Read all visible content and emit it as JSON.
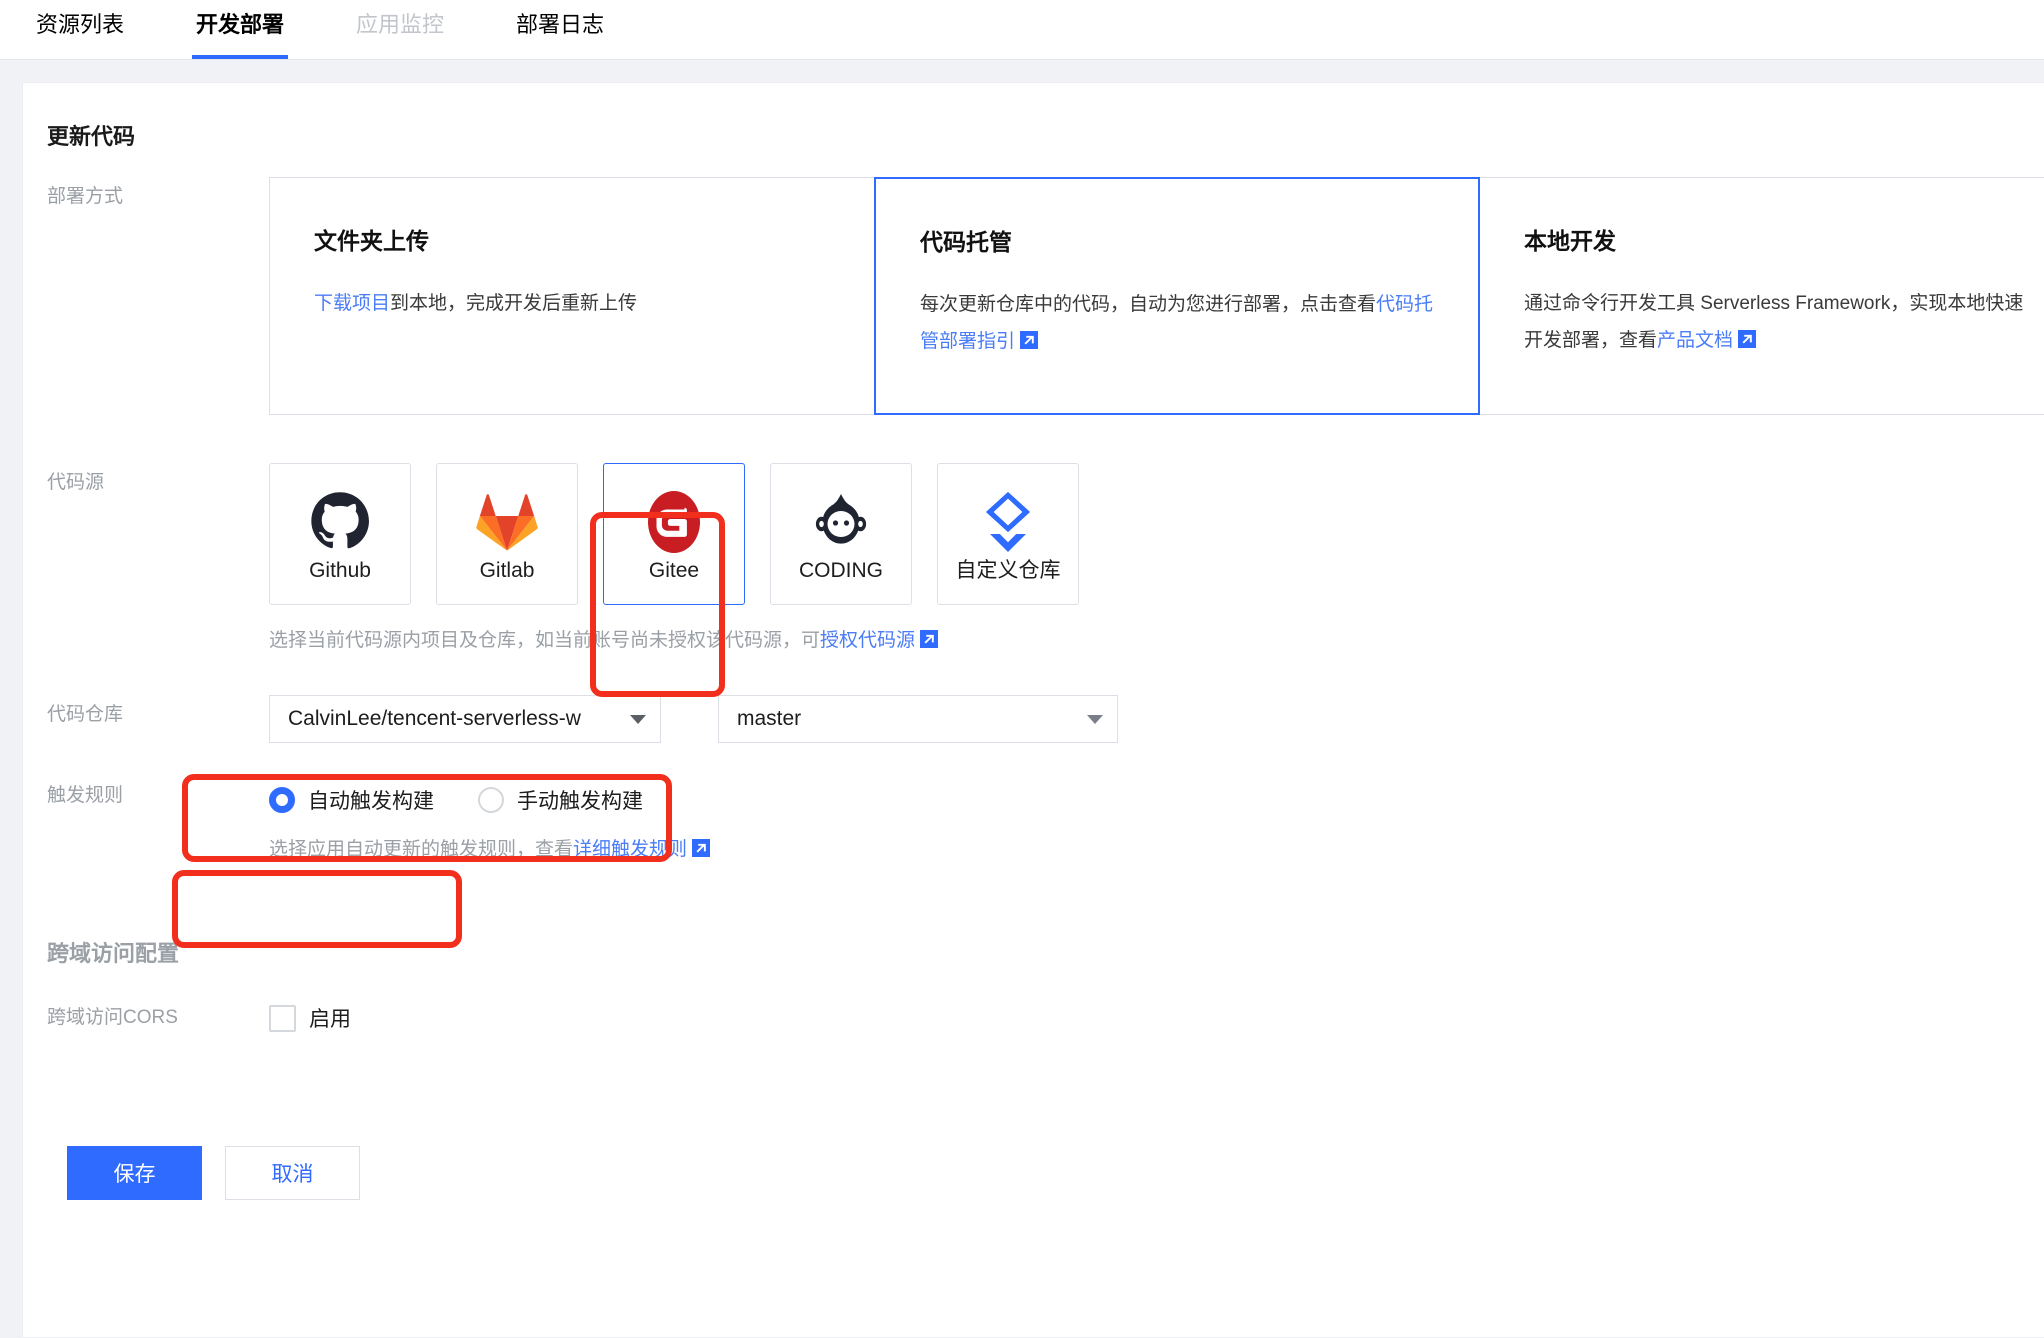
{
  "tabs": [
    {
      "label": "资源列表",
      "active": false,
      "muted": false
    },
    {
      "label": "开发部署",
      "active": true,
      "muted": false
    },
    {
      "label": "应用监控",
      "active": false,
      "muted": true
    },
    {
      "label": "部署日志",
      "active": false,
      "muted": false
    }
  ],
  "update_code": {
    "title": "更新代码",
    "deploy_method": {
      "label": "部署方式",
      "cards": [
        {
          "title": "文件夹上传",
          "desc_prefix": "",
          "link": "下载项目",
          "desc_suffix": "到本地，完成开发后重新上传",
          "has_external_icon": false,
          "selected": false
        },
        {
          "title": "代码托管",
          "desc_prefix": "每次更新仓库中的代码，自动为您进行部署，点击查看",
          "link": "代码托管部署指引",
          "desc_suffix": "",
          "has_external_icon": true,
          "selected": true
        },
        {
          "title": "本地开发",
          "desc_prefix": "通过命令行开发工具 Serverless Framework，实现本地快速开发部署，查看",
          "link": "产品文档",
          "desc_suffix": "",
          "has_external_icon": true,
          "selected": false
        }
      ]
    },
    "code_source": {
      "label": "代码源",
      "tiles": [
        {
          "label": "Github",
          "icon": "github-icon",
          "selected": false
        },
        {
          "label": "Gitlab",
          "icon": "gitlab-icon",
          "selected": false
        },
        {
          "label": "Gitee",
          "icon": "gitee-icon",
          "selected": true
        },
        {
          "label": "CODING",
          "icon": "coding-icon",
          "selected": false
        },
        {
          "label": "自定义仓库",
          "icon": "custom-repo-icon",
          "selected": false
        }
      ],
      "hint_prefix": "选择当前代码源内项目及仓库，如当前账号尚未授权该代码源，可",
      "hint_link": "授权代码源"
    },
    "code_repo": {
      "label": "代码仓库",
      "repo_value": "CalvinLee/tencent-serverless-w",
      "branch_value": "master"
    },
    "trigger_rule": {
      "label": "触发规则",
      "options": [
        {
          "label": "自动触发构建",
          "checked": true
        },
        {
          "label": "手动触发构建",
          "checked": false
        }
      ],
      "hint_prefix": "选择应用自动更新的触发规则，查看",
      "hint_link": "详细触发规则"
    }
  },
  "cors": {
    "title": "跨域访问配置",
    "label": "跨域访问CORS",
    "checkbox_label": "启用",
    "checked": false
  },
  "footer": {
    "save_label": "保存",
    "cancel_label": "取消"
  },
  "colors": {
    "accent": "#2f6bff",
    "link": "#4a7cf7",
    "annotation": "#f22f1d",
    "label_grey": "#9ba0a6",
    "page_bg": "#f0f2f5"
  }
}
